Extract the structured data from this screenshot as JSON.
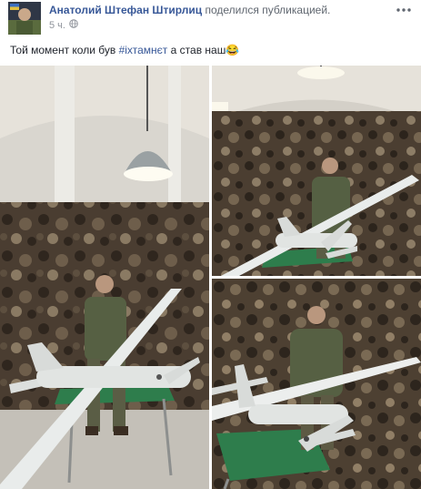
{
  "post": {
    "author": "Анатолий Штефан Штирлиц",
    "action": "поделился публикацией.",
    "time": "5 ч.",
    "text_before": "Той момент коли був ",
    "hashtag": "#іхтамнєт",
    "text_after": " а став наш",
    "emoji": "😂"
  },
  "colors": {
    "link": "#385898",
    "muted": "#90949c",
    "camo_dark": "#3b3128",
    "camo_light": "#8a7a63",
    "table_green": "#2e7d4c"
  },
  "icons": {
    "privacy": "globe-icon",
    "menu": "more-options-icon"
  },
  "photos": [
    {
      "name": "soldier-with-drone-photo-1"
    },
    {
      "name": "soldier-with-drone-photo-2"
    },
    {
      "name": "soldier-with-drone-photo-3"
    }
  ]
}
